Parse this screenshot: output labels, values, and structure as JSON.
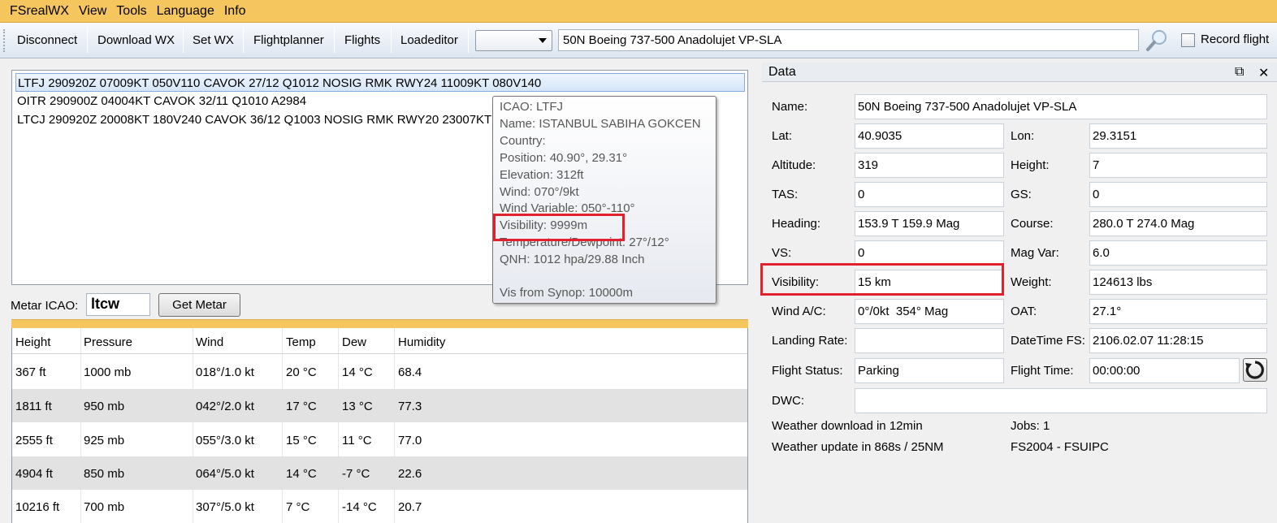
{
  "menu": [
    "FSrealWX",
    "View",
    "Tools",
    "Language",
    "Info"
  ],
  "toolbar": {
    "buttons": [
      "Disconnect",
      "Download WX",
      "Set WX",
      "Flightplanner",
      "Flights",
      "Loadeditor"
    ],
    "combo_value": "",
    "aircraft_name": "50N Boeing 737-500 Anadolujet VP-SLA",
    "record_flight_label": "Record flight",
    "record_flight_checked": false
  },
  "metars": [
    "LTFJ 290920Z 07009KT 050V110 CAVOK 27/12 Q1012 NOSIG RMK RWY24 11009KT 080V140",
    "OITR 290900Z 04004KT CAVOK 32/11 Q1010 A2984",
    "LTCJ 290920Z 20008KT 180V240 CAVOK 36/12 Q1003 NOSIG RMK RWY20 23007KT"
  ],
  "tooltip": {
    "lines": [
      "ICAO: LTFJ",
      "Name: ISTANBUL SABIHA GOKCEN",
      "Country:",
      "Position: 40.90°, 29.31°",
      "Elevation: 312ft",
      "Wind: 070°/9kt",
      "Wind Variable: 050°-110°",
      "Visibility: 9999m",
      "Temperature/Dewpoint: 27°/12°",
      "QNH: 1012 hpa/29.88 Inch",
      "",
      "Vis from Synop: 10000m"
    ]
  },
  "metar_icao": {
    "label": "Metar ICAO:",
    "value": "ltcw",
    "button": "Get Metar"
  },
  "weather_table": {
    "headers": [
      "Height",
      "Pressure",
      "Wind",
      "Temp",
      "Dew",
      "Humidity"
    ],
    "rows": [
      [
        "367 ft",
        "1000 mb",
        "018°/1.0 kt",
        "20 °C",
        "14 °C",
        "68.4"
      ],
      [
        "1811 ft",
        "950 mb",
        "042°/2.0 kt",
        "17 °C",
        "13 °C",
        "77.3"
      ],
      [
        "2555 ft",
        "925 mb",
        "055°/3.0 kt",
        "15 °C",
        "11 °C",
        "77.0"
      ],
      [
        "4904 ft",
        "850 mb",
        "064°/5.0 kt",
        "14 °C",
        "-7 °C",
        "22.6"
      ],
      [
        "10216 ft",
        "700 mb",
        "307°/5.0 kt",
        "7 °C",
        "-14 °C",
        "20.7"
      ]
    ]
  },
  "data_panel": {
    "title": "Data",
    "name_label": "Name:",
    "name_value": "50N Boeing 737-500 Anadolujet VP-SLA",
    "lat_label": "Lat:",
    "lat_value": "40.9035",
    "lon_label": "Lon:",
    "lon_value": "29.3151",
    "altitude_label": "Altitude:",
    "altitude_value": "319",
    "height_label": "Height:",
    "height_value": "7",
    "tas_label": "TAS:",
    "tas_value": "0",
    "gs_label": "GS:",
    "gs_value": "0",
    "heading_label": "Heading:",
    "heading_value": "153.9 T 159.9 Mag",
    "course_label": "Course:",
    "course_value": "280.0 T 274.0 Mag",
    "vs_label": "VS:",
    "vs_value": "0",
    "magvar_label": "Mag Var:",
    "magvar_value": "6.0",
    "visibility_label": "Visibility:",
    "visibility_value": "15 km",
    "weight_label": "Weight:",
    "weight_value": "124613 lbs",
    "wind_label": "Wind A/C:",
    "wind_value": "0°/0kt  354° Mag",
    "oat_label": "OAT:",
    "oat_value": "27.1°",
    "landing_label": "Landing Rate:",
    "landing_value": "",
    "datetime_label": "DateTime FS:",
    "datetime_value": "2106.02.07 11:28:15",
    "status_label": "Flight Status:",
    "status_value": "Parking",
    "flighttime_label": "Flight Time:",
    "flighttime_value": "00:00:00",
    "dwc_label": "DWC:",
    "dwc_value": "",
    "wx_download": "Weather download in 12min",
    "jobs": "Jobs: 1",
    "wx_update": "Weather update in 868s / 25NM",
    "sim": "FS2004 - FSUIPC"
  },
  "colors": {
    "menubar": "#f6c65e",
    "highlight_box": "#e2202e",
    "alt_row": "#e2e2e2"
  }
}
